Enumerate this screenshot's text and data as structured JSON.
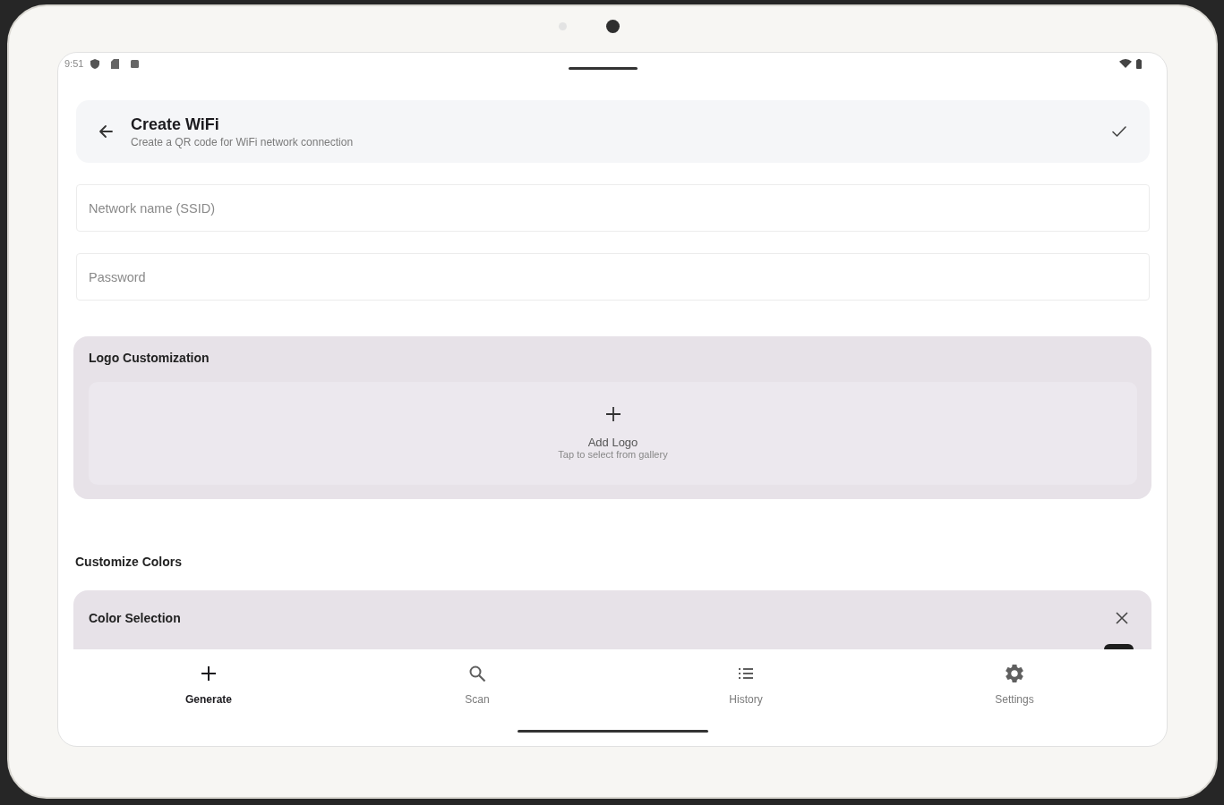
{
  "status_bar": {
    "time": "9:51"
  },
  "header": {
    "title": "Create WiFi",
    "subtitle": "Create a QR code for WiFi network connection"
  },
  "fields": [
    {
      "placeholder": "Network name (SSID)"
    },
    {
      "placeholder": "Password"
    }
  ],
  "logo_customization": {
    "title": "Logo Customization",
    "add_logo": {
      "label": "Add Logo",
      "hint": "Tap to select from gallery"
    }
  },
  "customize_colors": {
    "heading": "Customize Colors",
    "color_selection": {
      "title": "Color Selection"
    }
  },
  "bottom_nav": [
    {
      "label": "Generate",
      "selected": true
    },
    {
      "label": "Scan",
      "selected": false
    },
    {
      "label": "History",
      "selected": false
    },
    {
      "label": "Settings",
      "selected": false
    }
  ]
}
